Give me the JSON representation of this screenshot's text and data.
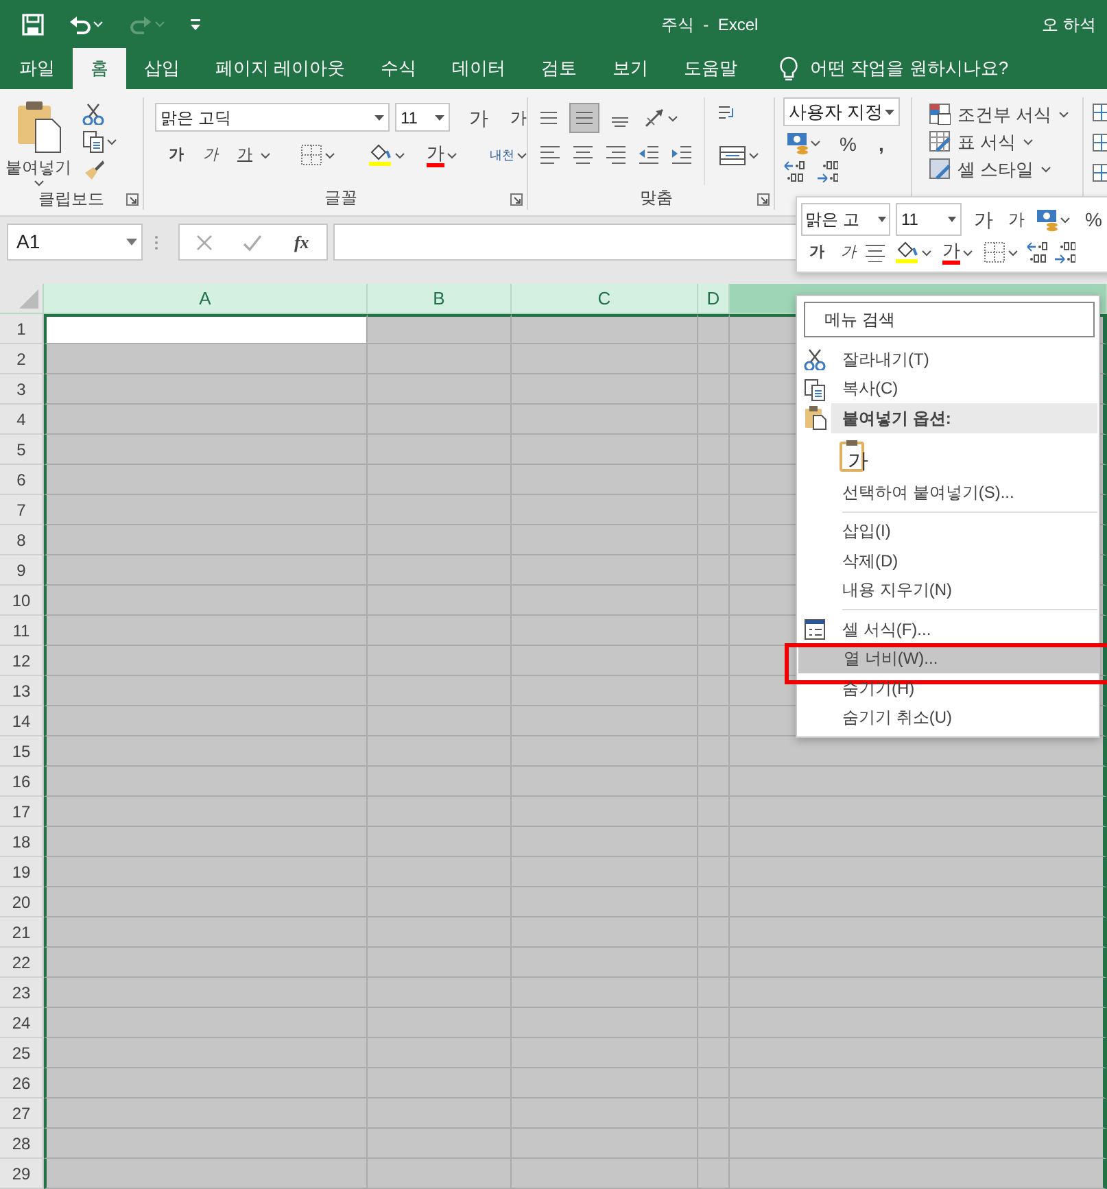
{
  "title_bar": {
    "title": "주식  -  Excel",
    "user": "오 하석"
  },
  "tabs": [
    {
      "label": "파일",
      "selected": false
    },
    {
      "label": "홈",
      "selected": true
    },
    {
      "label": "삽입",
      "selected": false
    },
    {
      "label": "페이지 레이아웃",
      "selected": false
    },
    {
      "label": "수식",
      "selected": false
    },
    {
      "label": "데이터",
      "selected": false
    },
    {
      "label": "검토",
      "selected": false
    },
    {
      "label": "보기",
      "selected": false
    },
    {
      "label": "도움말",
      "selected": false
    }
  ],
  "tell_me": "어떤 작업을 원하시나요?",
  "ribbon": {
    "clipboard": {
      "paste": "붙여넣기",
      "label": "클립보드"
    },
    "font": {
      "name": "맑은 고딕",
      "size": "11",
      "grow": "가",
      "shrink": "가",
      "bold": "가",
      "italic": "가",
      "underline": "가",
      "font_color_button": "가",
      "phonetic": "내천",
      "label": "글꼴"
    },
    "alignment": {
      "label": "맞춤"
    },
    "number": {
      "format": "사용자 지정",
      "percent": "%",
      "comma": ","
    },
    "styles": [
      "조건부 서식",
      "표 서식",
      "셀 스타일"
    ]
  },
  "formula_bar": {
    "name_box": "A1",
    "function": "fx"
  },
  "columns": [
    {
      "label": "A",
      "selected": true,
      "active": true,
      "hovered": false
    },
    {
      "label": "B",
      "selected": true,
      "active": false,
      "hovered": false
    },
    {
      "label": "C",
      "selected": true,
      "active": false,
      "hovered": false
    },
    {
      "label": "D",
      "selected": true,
      "active": false,
      "hovered": false
    },
    {
      "selected": true,
      "active": false,
      "hovered": true
    }
  ],
  "rows": [
    {
      "label": "1",
      "active": true
    },
    {
      "label": "2",
      "active": false
    },
    {
      "label": "3",
      "active": false
    },
    {
      "label": "4",
      "active": false
    },
    {
      "label": "5",
      "active": false
    },
    {
      "label": "6",
      "active": false
    },
    {
      "label": "7",
      "active": false
    },
    {
      "label": "8",
      "active": false
    },
    {
      "label": "9",
      "active": false
    },
    {
      "label": "10",
      "active": false
    },
    {
      "label": "11",
      "active": false
    },
    {
      "label": "12",
      "active": false
    },
    {
      "label": "13",
      "active": false
    },
    {
      "label": "14",
      "active": false
    },
    {
      "label": "15",
      "active": false
    },
    {
      "label": "16",
      "active": false
    },
    {
      "label": "17",
      "active": false
    },
    {
      "label": "18",
      "active": false
    },
    {
      "label": "19",
      "active": false
    },
    {
      "label": "20",
      "active": false
    },
    {
      "label": "21",
      "active": false
    },
    {
      "label": "22",
      "active": false
    },
    {
      "label": "23",
      "active": false
    },
    {
      "label": "24",
      "active": false
    },
    {
      "label": "25",
      "active": false
    },
    {
      "label": "26",
      "active": false
    },
    {
      "label": "27",
      "active": false
    },
    {
      "label": "28",
      "active": false
    },
    {
      "label": "29",
      "active": false
    }
  ],
  "mini_toolbar": {
    "font_name": "맑은 고",
    "size": "11",
    "grow": "가",
    "shrink": "가",
    "percent": "%",
    "bold": "가",
    "italic": "가",
    "font_color_button": "가"
  },
  "context_menu": {
    "search_placeholder": "메뉴 검색",
    "items": [
      {
        "kind": "command",
        "label": "잘라내기(T)",
        "selected": false,
        "highlighted": false
      },
      {
        "kind": "command",
        "label": "복사(C)",
        "selected": false,
        "highlighted": false
      },
      {
        "kind": "header",
        "label": "붙여넣기 옵션:"
      },
      {
        "kind": "paste_option",
        "label": "가"
      },
      {
        "kind": "command",
        "label": "선택하여 붙여넣기(S)...",
        "selected": false,
        "highlighted": false
      },
      {
        "kind": "separator"
      },
      {
        "kind": "command",
        "label": "삽입(I)",
        "selected": false,
        "highlighted": false
      },
      {
        "kind": "command",
        "label": "삭제(D)",
        "selected": false,
        "highlighted": false
      },
      {
        "kind": "command",
        "label": "내용 지우기(N)",
        "selected": false,
        "highlighted": false
      },
      {
        "kind": "separator"
      },
      {
        "kind": "command",
        "label": "셀 서식(F)...",
        "selected": false,
        "highlighted": false
      },
      {
        "kind": "command",
        "label": "열 너비(W)...",
        "selected": true,
        "highlighted": true
      },
      {
        "kind": "command",
        "label": "숨기기(H)",
        "selected": false,
        "highlighted": false
      },
      {
        "kind": "command",
        "label": "숨기기 취소(U)",
        "selected": false,
        "highlighted": false
      }
    ]
  }
}
